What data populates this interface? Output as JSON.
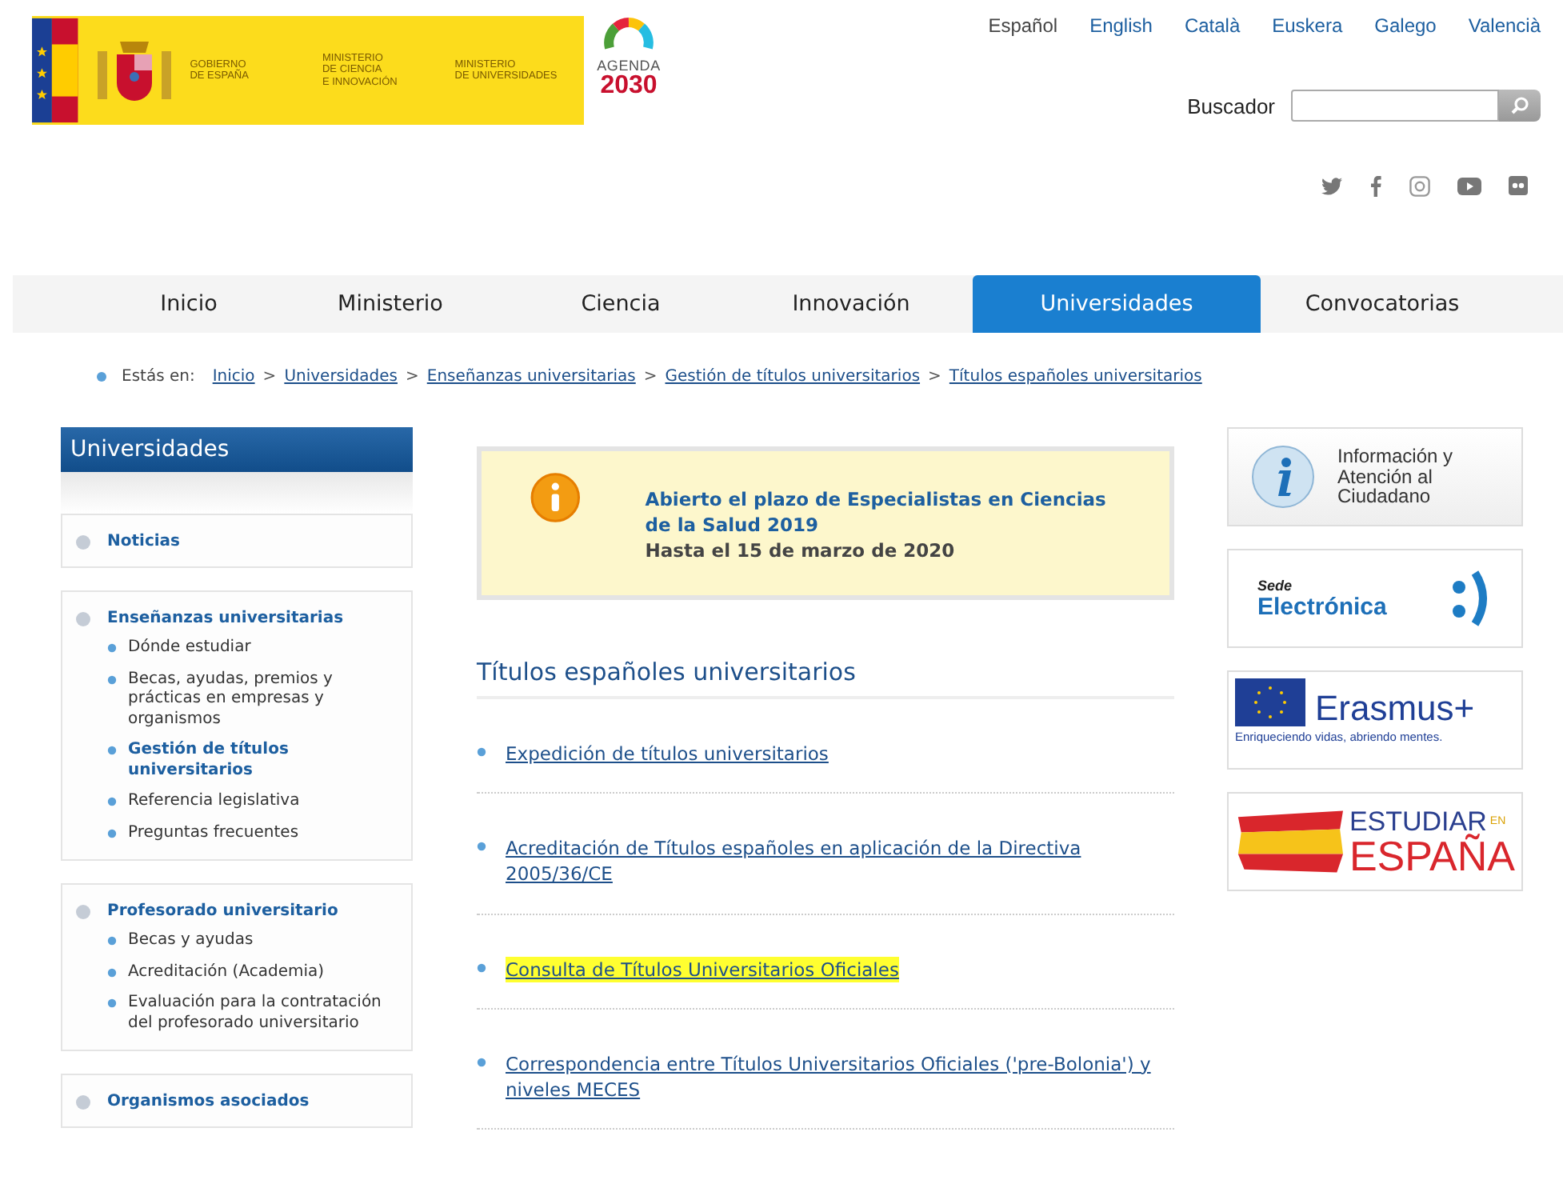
{
  "logo": {
    "government": [
      "GOBIERNO",
      "DE ESPAÑA"
    ],
    "ministries": [
      [
        "MINISTERIO",
        "DE CIENCIA",
        "E INNOVACIÓN"
      ],
      [
        "MINISTERIO",
        "DE UNIVERSIDADES"
      ]
    ],
    "agenda": {
      "label": "AGENDA",
      "year": "2030"
    }
  },
  "languages": [
    {
      "label": "Español",
      "selected": true
    },
    {
      "label": "English",
      "selected": false
    },
    {
      "label": "Català",
      "selected": false
    },
    {
      "label": "Euskera",
      "selected": false
    },
    {
      "label": "Galego",
      "selected": false
    },
    {
      "label": "Valencià",
      "selected": false
    }
  ],
  "search": {
    "label": "Buscador"
  },
  "nav": [
    {
      "label": "Inicio",
      "selected": false
    },
    {
      "label": "Ministerio",
      "selected": false
    },
    {
      "label": "Ciencia",
      "selected": false
    },
    {
      "label": "Innovación",
      "selected": false
    },
    {
      "label": "Universidades",
      "selected": true
    },
    {
      "label": "Convocatorias",
      "selected": false
    }
  ],
  "breadcrumb": {
    "label": "Estás en:",
    "separator": ">",
    "items": [
      "Inicio",
      "Universidades",
      "Enseñanzas universitarias",
      "Gestión de títulos universitarios",
      "Títulos españoles universitarios"
    ]
  },
  "sidebar": {
    "title": "Universidades",
    "sections": [
      {
        "label": "Noticias"
      },
      {
        "label": "Enseñanzas universitarias",
        "children": [
          {
            "label": "Dónde estudiar",
            "selected": false
          },
          {
            "label": "Becas, ayudas, premios y prácticas en empresas y organismos",
            "selected": false
          },
          {
            "label": "Gestión de títulos universitarios",
            "selected": true
          },
          {
            "label": "Referencia legislativa",
            "selected": false
          },
          {
            "label": "Preguntas frecuentes",
            "selected": false
          }
        ]
      },
      {
        "label": "Profesorado universitario",
        "children": [
          {
            "label": "Becas y ayudas",
            "selected": false
          },
          {
            "label": "Acreditación (Academia)",
            "selected": false
          },
          {
            "label": "Evaluación para la contratación del profesorado universitario",
            "selected": false
          }
        ]
      },
      {
        "label": "Organismos asociados"
      }
    ]
  },
  "notice": {
    "title": "Abierto el plazo de Especialistas en Ciencias de la Salud 2019",
    "date": "Hasta el 15 de marzo de 2020"
  },
  "heading": "Títulos españoles universitarios",
  "links": [
    {
      "label": "Expedición de títulos universitarios",
      "highlighted": false
    },
    {
      "label": "Acreditación de Títulos españoles en aplicación de la Directiva 2005/36/CE",
      "highlighted": false
    },
    {
      "label": "Consulta de Títulos Universitarios Oficiales",
      "highlighted": true
    },
    {
      "label": "Correspondencia entre Títulos Universitarios Oficiales ('pre-Bolonia') y niveles MECES",
      "highlighted": false
    }
  ],
  "banners": [
    {
      "kind": "info",
      "lines": [
        "Información y",
        "Atención al",
        "Ciudadano"
      ]
    },
    {
      "kind": "sede",
      "lines": [
        "Sede",
        "Electrónica"
      ]
    },
    {
      "kind": "erasmus",
      "lines": [
        "Erasmus+",
        "Enriqueciendo vidas, abriendo mentes."
      ]
    },
    {
      "kind": "estudiar",
      "lines": [
        "ESTUDIAR",
        "EN",
        "ESPAÑA"
      ]
    }
  ]
}
